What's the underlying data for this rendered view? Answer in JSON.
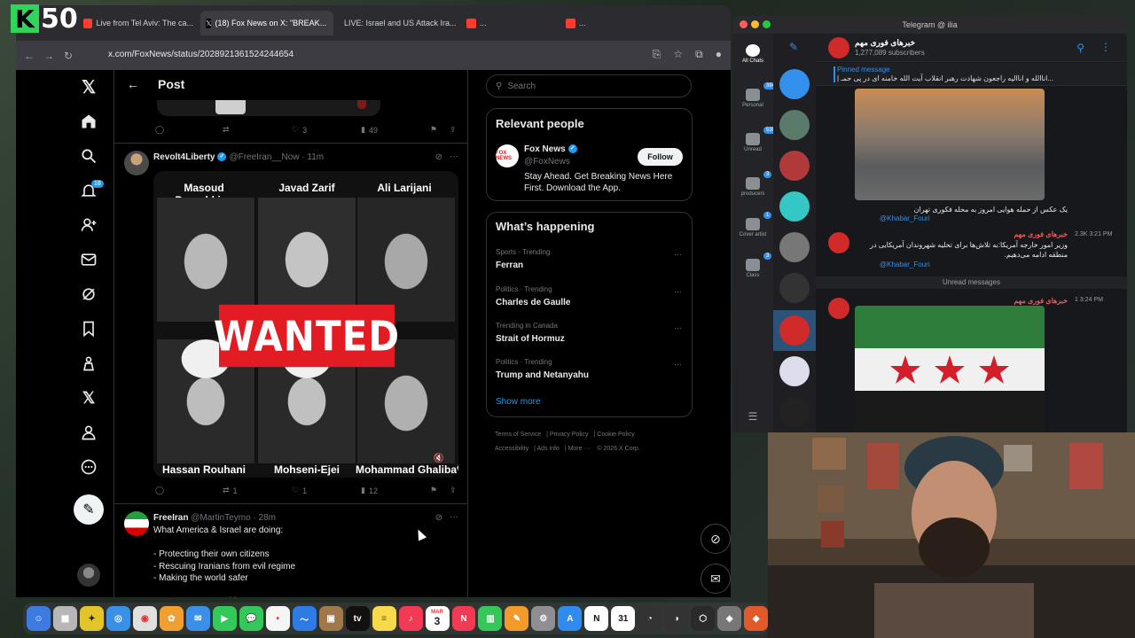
{
  "logo": {
    "letter": "K",
    "number": "50"
  },
  "browser": {
    "tabs": [
      {
        "label": "Live from Tel Aviv: The ca...",
        "active": false
      },
      {
        "label": "(18) Fox News on X: \"BREAK...",
        "active": true
      },
      {
        "label": "LIVE: Israel and US Attack Ira...",
        "active": false
      },
      {
        "label": "...",
        "active": false
      },
      {
        "label": "...",
        "active": false
      }
    ],
    "url": "x.com/FoxNews/status/2028921361524244654"
  },
  "x": {
    "header_title": "Post",
    "nav_badge": "18",
    "prev_tweet_actions": {
      "retweets": "",
      "likes": "3",
      "views": "49"
    },
    "tweet1": {
      "name": "Revolt4Liberty",
      "handle": "@FreeIran__Now · 11m",
      "image": {
        "top_names": [
          "Masoud Pezeshkian",
          "Javad Zarif",
          "Ali Larijani"
        ],
        "bottom_names": [
          "Hassan Rouhani",
          "Mohseni-Ejei",
          "Mohammad Ghalibaf"
        ],
        "banner": "WANTED"
      },
      "actions": {
        "replies": "",
        "retweets": "1",
        "likes": "1",
        "views": "12"
      }
    },
    "tweet2": {
      "name": "FreeIran",
      "handle": "@MartinTeymo · 28m",
      "text": "What America & Israel are doing:\n\n- Protecting their own citizens\n- Rescuing Iranians from evil regime\n- Making the world safer\n\nGod bless USA 🇺🇸❤️"
    },
    "search_placeholder": "Search",
    "relevant": {
      "title": "Relevant people",
      "name": "Fox News",
      "handle": "@FoxNews",
      "bio": "Stay Ahead. Get Breaking News Here First. Download the App.",
      "follow": "Follow",
      "avatar_text": "FOX NEWS"
    },
    "happening": {
      "title": "What’s happening",
      "trends": [
        {
          "category": "Sports · Trending",
          "title": "Ferran"
        },
        {
          "category": "Politics · Trending",
          "title": "Charles de Gaulle"
        },
        {
          "category": "Trending in Canada",
          "title": "Strait of Hormuz"
        },
        {
          "category": "Politics · Trending",
          "title": "Trump and Netanyahu"
        }
      ],
      "show_more": "Show more"
    },
    "footer": {
      "terms": "Terms of Service",
      "privacy": "Privacy Policy",
      "cookie": "Cookie Policy",
      "accessibility": "Accessibility",
      "ads": "Ads info",
      "more": "More ···",
      "copyright": "© 2026 X Corp."
    }
  },
  "telegram": {
    "title": "Telegram @ ilia",
    "folders": [
      {
        "label": "All Chats",
        "badge": ""
      },
      {
        "label": "Personal",
        "badge": "394"
      },
      {
        "label": "Unread",
        "badge": "530"
      },
      {
        "label": "producers",
        "badge": "3"
      },
      {
        "label": "Cover artist",
        "badge": "1"
      },
      {
        "label": "Class",
        "badge": "3"
      }
    ],
    "chat_name": "خبرهای فوری مهم",
    "subscribers": "1,277,089 subscribers",
    "pinned_label": "Pinned message",
    "pinned_text": "| اناالله و اناالیه راجعون شهادت رهبر انقلاب آیت الله خامنه ای در پی حمـ...",
    "msg1_text": "یک عکس از حمله هوایی امروز به محله فکوری تهران",
    "msg1_link": "@Khabar_Fouri",
    "msg2_sender": "خبرهای فوری مهم",
    "msg2_text": "وزیر امور خارجه آمریکا:به تلاش‌ها برای تخلیه شهروندان آمریکایی در منطقه ادامه می‌دهیم.",
    "msg2_link": "@Khabar_Fouri",
    "msg2_meta": "2.3K 3:21 PM",
    "unread": "Unread messages",
    "msg3_sender": "خبرهای فوری مهم",
    "msg3_meta": "1 3:24 PM"
  },
  "dock": {
    "calendar_month": "MAR",
    "calendar_day": "3",
    "calendar2_day": "31"
  }
}
